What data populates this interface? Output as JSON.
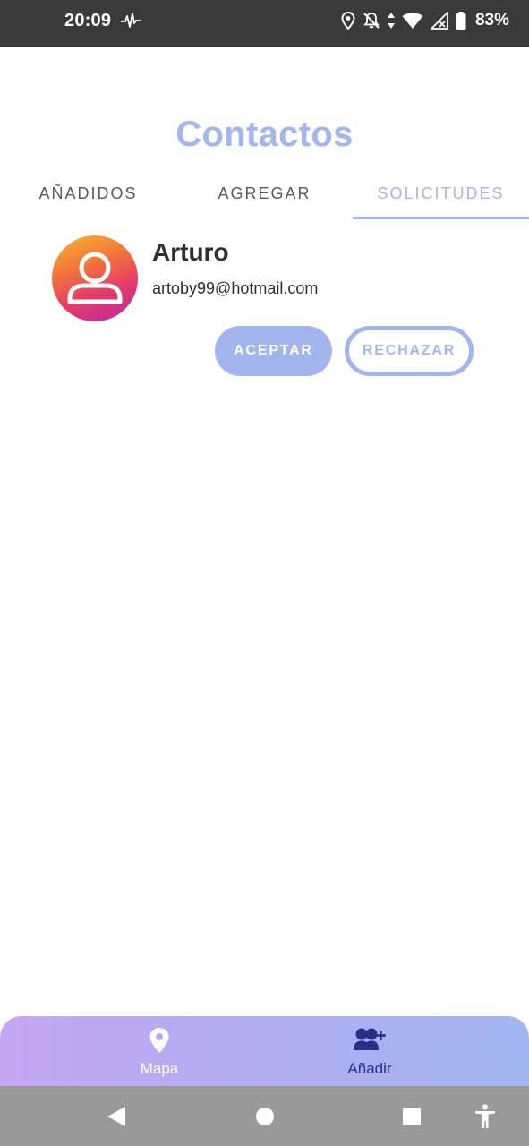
{
  "status_bar": {
    "time": "20:09",
    "battery": "83%",
    "icons": [
      "pulse-icon",
      "location-icon",
      "bell-off-icon",
      "data-arrows-icon",
      "wifi-icon",
      "signal-icon",
      "battery-icon"
    ]
  },
  "page": {
    "title": "Contactos"
  },
  "tabs": [
    {
      "label": "AÑADIDOS",
      "active": false
    },
    {
      "label": "AGREGAR",
      "active": false
    },
    {
      "label": "SOLICITUDES",
      "active": true
    }
  ],
  "requests": [
    {
      "name": "Arturo",
      "email": "artoby99@hotmail.com",
      "accept_label": "ACEPTAR",
      "reject_label": "RECHAZAR"
    }
  ],
  "bottom_nav": {
    "items": [
      {
        "label": "Mapa",
        "icon": "location-pin-icon"
      },
      {
        "label": "Añadir",
        "icon": "add-user-icon"
      }
    ]
  },
  "system_nav": {
    "buttons": [
      "back-icon",
      "home-icon",
      "recents-icon",
      "accessibility-icon"
    ]
  },
  "colors": {
    "accent": "#a3b5ee",
    "status_bar": "#3a3a3a",
    "nav_gradient_start": "#c4a6f5",
    "nav_gradient_end": "#a1b5f2",
    "active_nav_label": "#2c2d86"
  }
}
